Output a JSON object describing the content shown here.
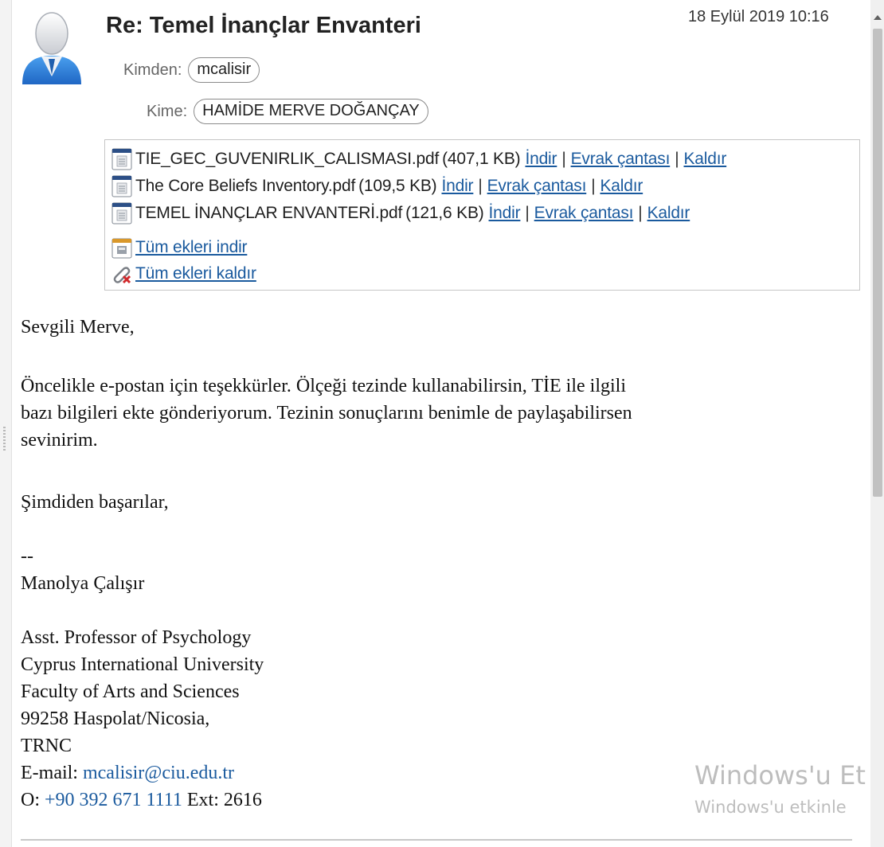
{
  "email": {
    "subject": "Re: Temel İnançlar Envanteri",
    "date": "18 Eylül 2019 10:16",
    "from_label": "Kimden:",
    "from": "mcalisir",
    "to_label": "Kime:",
    "to": "HAMİDE MERVE DOĞANÇAY"
  },
  "attachments": {
    "files": [
      {
        "name": "TIE_GEC_GUVENIRLIK_CALISMASI.pdf",
        "size": "(407,1 KB)",
        "download": "İndir",
        "briefcase": "Evrak çantası",
        "remove": "Kaldır"
      },
      {
        "name": "The Core Beliefs Inventory.pdf",
        "size": "(109,5 KB)",
        "download": "İndir",
        "briefcase": "Evrak çantası",
        "remove": "Kaldır"
      },
      {
        "name": "TEMEL İNANÇLAR ENVANTERİ.pdf",
        "size": "(121,6 KB)",
        "download": "İndir",
        "briefcase": "Evrak çantası",
        "remove": "Kaldır"
      }
    ],
    "download_all": "Tüm ekleri indir",
    "remove_all": "Tüm ekleri kaldır",
    "separator": "|"
  },
  "body": {
    "greeting": "Sevgili Merve,",
    "paragraph_lines": [
      "Öncelikle e-postan için teşekkürler. Ölçeği tezinde kullanabilirsin, TİE ile ilgili",
      "bazı bilgileri ekte gönderiyorum. Tezinin sonuçlarını benimle de paylaşabilirsen",
      "sevinirim."
    ],
    "closing": "Şimdiden başarılar,",
    "signature": {
      "dashes": "--",
      "name": "Manolya Çalışır",
      "title": "Asst. Professor of Psychology",
      "university": "Cyprus International University",
      "faculty": "Faculty of Arts and Sciences",
      "address": "99258 Haspolat/Nicosia,",
      "country": "TRNC",
      "email_label": "E-mail:",
      "email": "mcalisir@ciu.edu.tr",
      "phone_label": "O:",
      "phone": "+90 392 671 1111",
      "ext": "Ext: 2616"
    }
  },
  "watermark": {
    "line1": "Windows'u Et",
    "line2": "Windows'u etkinle"
  },
  "icons": {
    "avatar": "user-avatar-icon",
    "pdf": "pdf-file-icon",
    "download_all": "download-all-icon",
    "remove_all": "paperclip-remove-icon"
  },
  "colors": {
    "link": "#1a5a9e",
    "avatar_blue": "#2f7fd6"
  }
}
